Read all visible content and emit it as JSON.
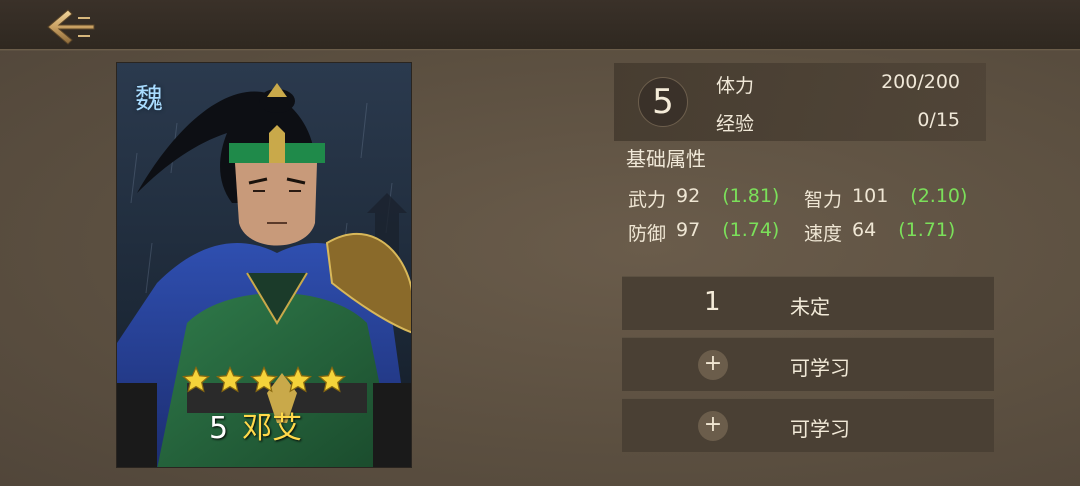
{
  "nav": {
    "back_icon": "back-arrow-icon"
  },
  "hero": {
    "faction": "魏",
    "star_count": 5,
    "level_label": "5",
    "name": "邓艾"
  },
  "status": {
    "level": "5",
    "stamina_label": "体力",
    "stamina_value": "200/200",
    "exp_label": "经验",
    "exp_value": "0/15"
  },
  "attributes": {
    "title": "基础属性",
    "items": [
      {
        "label": "武力",
        "value": "92",
        "growth": "(1.81)"
      },
      {
        "label": "智力",
        "value": "101",
        "growth": "(2.10)"
      },
      {
        "label": "防御",
        "value": "97",
        "growth": "(1.74)"
      },
      {
        "label": "速度",
        "value": "64",
        "growth": "(1.71)"
      }
    ]
  },
  "skills": [
    {
      "index": "1",
      "label": "未定"
    },
    {
      "icon": "plus-icon",
      "label": "可学习"
    },
    {
      "icon": "plus-icon",
      "label": "可学习"
    }
  ],
  "colors": {
    "background": "#5d5142",
    "growth_green": "#7be05a",
    "hero_name_yellow": "#ffd94a",
    "faction_blue": "#a9dcff"
  }
}
